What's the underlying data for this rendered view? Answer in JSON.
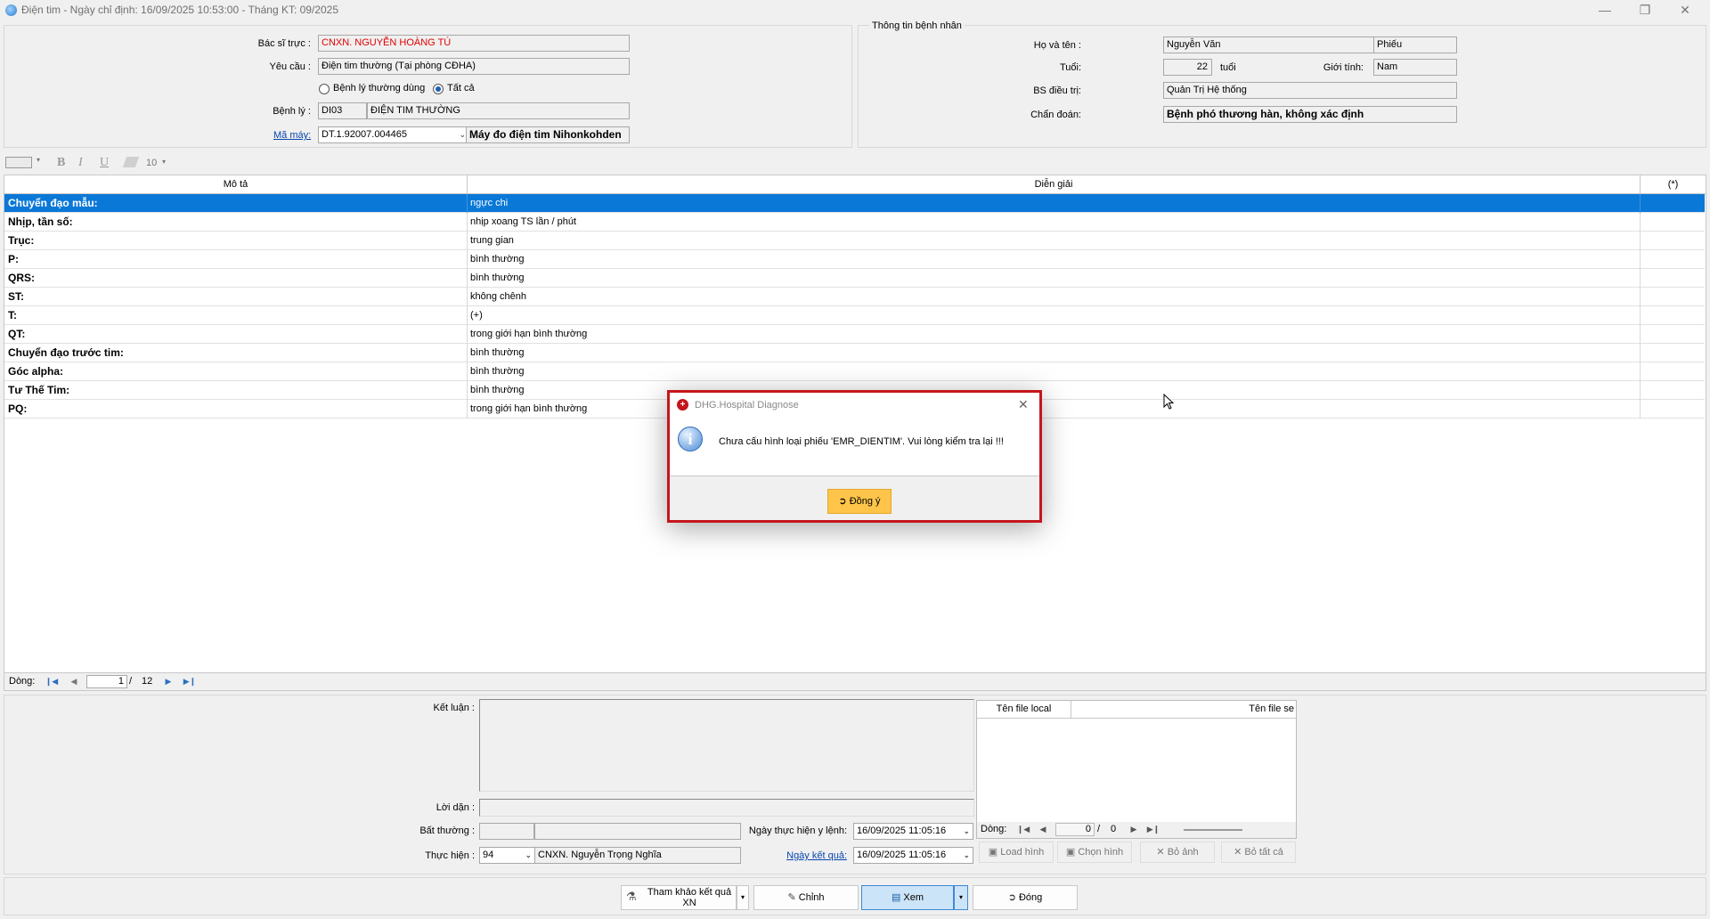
{
  "window": {
    "title": "Điện tim - Ngày chỉ định: 16/09/2025 10:53:00 - Tháng KT: 09/2025",
    "minimize": "—",
    "restore": "❐",
    "close": "✕"
  },
  "request": {
    "doctor_label": "Bác sĩ trực :",
    "doctor_value": "CNXN. NGUYỄN HOÀNG TÚ",
    "request_label": "Yêu cầu :",
    "request_value": "Điện tim thường (Tại phòng CĐHA)",
    "radio_common": "Bệnh lý thường dùng",
    "radio_all": "Tất cả",
    "disease_label": "Bệnh lý :",
    "disease_code": "DI03",
    "disease_name": "ĐIỆN TIM THƯỜNG",
    "machine_label": "Mã máy:",
    "machine_code": "DT.1.92007.004465",
    "machine_name": "Máy đo điện tim Nihonkohden"
  },
  "patient": {
    "group_title": "Thông tin bệnh nhân",
    "name_label": "Họ và tên :",
    "name_value": "Nguyễn Văn",
    "name_suffix": "Phiếu",
    "age_label": "Tuổi:",
    "age_value": "22",
    "age_unit": "tuổi",
    "sex_label": "Giới tính:",
    "sex_value": "Nam",
    "bs_label": "BS điều trị:",
    "bs_value": "Quản Trị Hệ thống",
    "diag_label": "Chẩn đoán:",
    "diag_value": "Bệnh phó thương hàn, không xác định"
  },
  "toolbar": {
    "bold": "B",
    "italic": "I",
    "underline": "U",
    "font_size": "10"
  },
  "grid": {
    "headers": [
      "Mô tả",
      "Diễn giải",
      "(*)"
    ],
    "rows": [
      {
        "desc": "Chuyển đạo mẫu:",
        "value": "ngực chi"
      },
      {
        "desc": "Nhịp, tần số:",
        "value": "nhịp xoang TS  lần / phút"
      },
      {
        "desc": "Trục:",
        "value": "trung gian"
      },
      {
        "desc": "P:",
        "value": "bình thường"
      },
      {
        "desc": "QRS:",
        "value": "bình thường"
      },
      {
        "desc": "ST:",
        "value": "không chênh"
      },
      {
        "desc": "T:",
        "value": "(+)"
      },
      {
        "desc": "QT:",
        "value": "trong giới hạn bình thường"
      },
      {
        "desc": "Chuyển đạo trước tim:",
        "value": "bình thường"
      },
      {
        "desc": "Góc alpha:",
        "value": "bình thường"
      },
      {
        "desc": "Tư Thế Tim:",
        "value": "bình thường"
      },
      {
        "desc": "PQ:",
        "value": "trong giới hạn bình thường"
      }
    ],
    "footer_label": "Dòng:",
    "page_current": "1",
    "page_sep": "/",
    "page_total": "12"
  },
  "conclusion": {
    "ket_luan_label": "Kết luận :",
    "loi_dan_label": "Lời dặn :",
    "bat_thuong_label": "Bất thường :",
    "thuc_hien_label": "Thực hiện :",
    "thuc_hien_code": "94",
    "thuc_hien_name": "CNXN. Nguyễn Trọng Nghĩa",
    "ngay_thuc_hien_label": "Ngày thực hiện y lệnh:",
    "ngay_thuc_hien_value": "16/09/2025 11:05:16",
    "ngay_ket_qua_label": "Ngày kết quả:",
    "ngay_ket_qua_value": "16/09/2025 11:05:16"
  },
  "files": {
    "col_local": "Tên file local",
    "col_server": "Tên file se",
    "footer_label": "Dòng:",
    "page_current": "0",
    "page_sep": "/",
    "page_total": "0",
    "load_label": "Load hình",
    "choose_label": "Chọn hình",
    "remove_label": "Bỏ ảnh",
    "remove_all_label": "Bỏ tất cả"
  },
  "bottom_buttons": {
    "reference": "Tham khảo kết quả XN",
    "edit": "Chỉnh",
    "view": "Xem",
    "close": "Đóng"
  },
  "dialog": {
    "title": "DHG.Hospital Diagnose",
    "message": "Chưa cấu hình loại phiếu 'EMR_DIENTIM'. Vui lòng kiểm tra lại !!!",
    "ok": "Đồng ý"
  },
  "colors": {
    "selection": "#0a78d7",
    "link": "#0645ad",
    "doctor_red": "#e00000",
    "dialog_border": "#c4161c",
    "ok_button": "#ffc54a"
  }
}
